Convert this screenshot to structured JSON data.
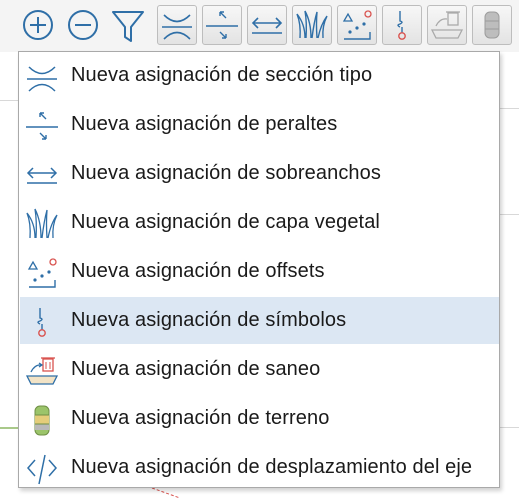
{
  "toolbar": {
    "buttons": [
      {
        "icon": "zoom-in-icon"
      },
      {
        "icon": "zoom-out-icon"
      },
      {
        "icon": "filter-icon"
      },
      {
        "icon": "cross-section-icon"
      },
      {
        "icon": "superelevation-icon"
      },
      {
        "icon": "widening-icon"
      },
      {
        "icon": "vegetation-icon"
      },
      {
        "icon": "offsets-icon"
      },
      {
        "icon": "symbols-icon"
      },
      {
        "icon": "sanitation-icon"
      },
      {
        "icon": "terrain-icon"
      }
    ]
  },
  "menu": {
    "items": [
      {
        "label": "Nueva asignación de sección tipo",
        "icon": "cross-section-icon"
      },
      {
        "label": "Nueva asignación de peraltes",
        "icon": "superelevation-icon"
      },
      {
        "label": "Nueva asignación de sobreanchos",
        "icon": "widening-icon"
      },
      {
        "label": "Nueva asignación de capa vegetal",
        "icon": "vegetation-icon"
      },
      {
        "label": "Nueva asignación de offsets",
        "icon": "offsets-icon"
      },
      {
        "label": "Nueva asignación de símbolos",
        "icon": "symbols-icon"
      },
      {
        "label": "Nueva asignación de saneo",
        "icon": "sanitation-icon"
      },
      {
        "label": "Nueva asignación de terreno",
        "icon": "terrain-icon"
      },
      {
        "label": "Nueva asignación de desplazamiento del eje",
        "icon": "axis-offset-icon"
      }
    ],
    "highlighted_index": 5
  },
  "colors": {
    "icon_blue": "#2f6fa7",
    "highlight": "#dce7f3",
    "accent_red": "#d9534f"
  }
}
